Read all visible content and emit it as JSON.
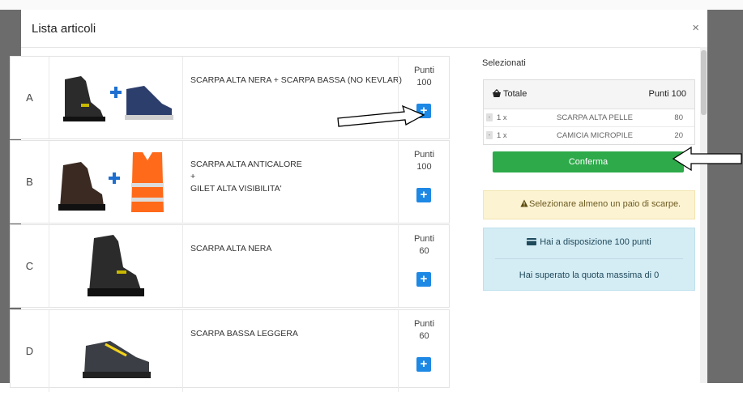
{
  "modal": {
    "title": "Lista articoli",
    "close_label": "×"
  },
  "articles": [
    {
      "letter": "A",
      "desc_lines": [
        "SCARPA ALTA NERA + SCARPA BASSA (NO KEVLAR)"
      ],
      "points_label": "Punti",
      "points": "100",
      "add_label": "+"
    },
    {
      "letter": "B",
      "desc_lines": [
        "SCARPA ALTA ANTICALORE",
        "+",
        "GILET ALTA VISIBILITA'"
      ],
      "points_label": "Punti",
      "points": "100",
      "add_label": "+"
    },
    {
      "letter": "C",
      "desc_lines": [
        "SCARPA ALTA NERA"
      ],
      "points_label": "Punti",
      "points": "60",
      "add_label": "+"
    },
    {
      "letter": "D",
      "desc_lines": [
        "SCARPA BASSA LEGGERA"
      ],
      "points_label": "Punti",
      "points": "60",
      "add_label": "+"
    }
  ],
  "selected": {
    "title": "Selezionati",
    "total_label": "Totale",
    "total_points": "Punti 100",
    "rows": [
      {
        "qty": "1 x",
        "name": "SCARPA ALTA PELLE",
        "points": "80"
      },
      {
        "qty": "1 x",
        "name": "CAMICIA MICROPILE",
        "points": "20"
      }
    ]
  },
  "confirm_label": "Conferma",
  "warning_text": "Selezionare almeno un paio di scarpe.",
  "info": {
    "available_text": "Hai a disposizione 100 punti",
    "quota_text": "Hai superato la quota massima di 0"
  },
  "colors": {
    "primary": "#1e88e5",
    "success": "#2eaa4a",
    "warning_bg": "#fcf3d2",
    "info_bg": "#d4ecf4",
    "backdrop": "#6c6c6c"
  }
}
